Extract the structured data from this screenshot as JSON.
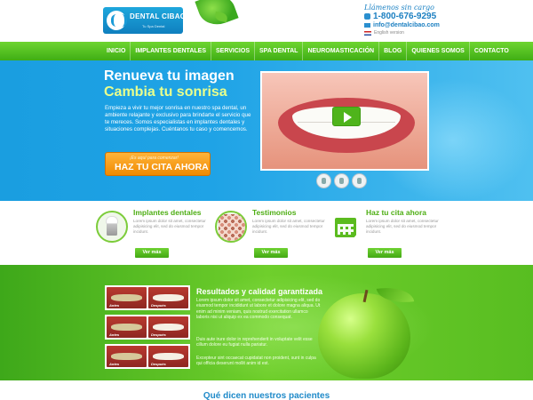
{
  "header": {
    "logo_name": "DENTAL CIBAO",
    "logo_tagline": "Tu Spa Dental",
    "contact": {
      "slogan": "Llámenos sin cargo",
      "phone": "1-800-676-9295",
      "email": "info@dentalcibao.com",
      "language_link": "English version"
    }
  },
  "nav": {
    "items": [
      "INICIO",
      "IMPLANTES DENTALES",
      "SERVICIOS",
      "SPA DENTAL",
      "NEUROMASTICACIÓN",
      "BLOG",
      "QUIENES SOMOS",
      "CONTACTO"
    ]
  },
  "hero": {
    "title_line1": "Renueva tu imagen",
    "title_line2": "Cambia tu sonrisa",
    "body": "Empieza a vivir tu mejor sonrisa en nuestro spa dental, un ambiente relajante y exclusivo para brindarte el servicio que te mereces. Somos especialistas en implantes dentales y situaciones complejas. Cuéntanos tu caso y comencemos.",
    "cta_small": "¡Es aquí para comenzar!",
    "cta_label": "HAZ TU CITA AHORA"
  },
  "services": [
    {
      "title": "Implantes dentales",
      "text": "Lorem ipsum dolor sit amet, consectetur adipisicing elit, sed do eiusmod tempor incidunt.",
      "button": "Ver más",
      "icon": "implant-icon"
    },
    {
      "title": "Testimonios",
      "text": "Lorem ipsum dolor sit amet, consectetur adipisicing elit, sed do eiusmod tempor incidunt.",
      "button": "Ver más",
      "icon": "testimonials-photo"
    },
    {
      "title": "Haz tu cita ahora",
      "text": "Lorem ipsum dolor sit amet, consectetur adipisicing elit, sed do eiusmod tempor incidunt.",
      "button": "Ver más",
      "icon": "calendar-icon"
    }
  ],
  "results": {
    "title": "Resultados y calidad garantizada",
    "paragraphs": [
      "Lorem ipsum dolor sit amet, consectetur adipisicing elit, sed do eiusmod tempor incididunt ut labore et dolore magna aliqua. Ut enim ad minim veniam, quis nostrud exercitation ullamco laboris nisi ut aliquip ex ea commodo consequat.",
      "Duis aute irure dolor in reprehenderit in voluptate velit esse cillum dolore eu fugiat nulla pariatur.",
      "Excepteur sint occaecat cupidatat non proident, sunt in culpa qui officia deserunt mollit anim id est."
    ],
    "before_label": "Antes",
    "after_label": "Después"
  },
  "testimonials": {
    "title": "Qué dicen nuestros pacientes"
  },
  "colors": {
    "brand_blue": "#1a9ee0",
    "brand_green": "#4eae14",
    "cta_orange": "#f08a00"
  }
}
